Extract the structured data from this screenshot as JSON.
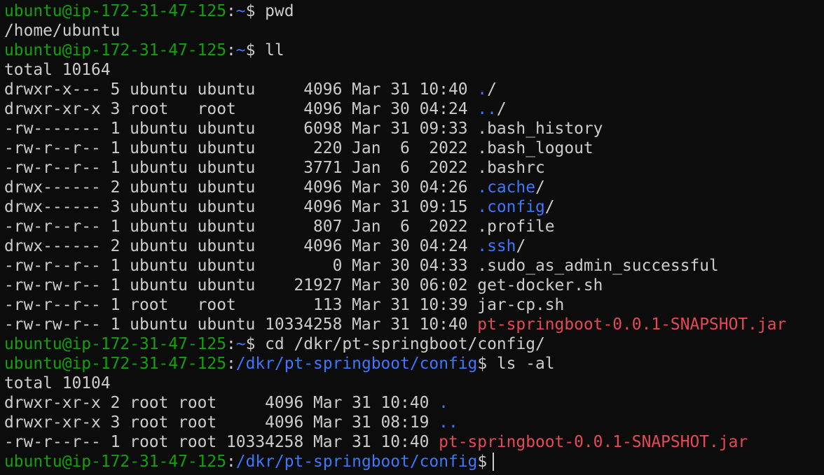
{
  "colors": {
    "background": "#0c0c0c",
    "text": "#cccccc",
    "prompt_user": "#13a10e",
    "prompt_path": "#3b78ff",
    "directory": "#3b78ff",
    "archive": "#e74856"
  },
  "lines": [
    {
      "segs": [
        {
          "t": "ubuntu@ip-172-31-47-125",
          "c": "u"
        },
        {
          "t": ":",
          "c": "w"
        },
        {
          "t": "~",
          "c": "p"
        },
        {
          "t": "$ pwd",
          "c": "w"
        }
      ]
    },
    {
      "segs": [
        {
          "t": "/home/ubuntu",
          "c": "w"
        }
      ]
    },
    {
      "segs": [
        {
          "t": "ubuntu@ip-172-31-47-125",
          "c": "u"
        },
        {
          "t": ":",
          "c": "w"
        },
        {
          "t": "~",
          "c": "p"
        },
        {
          "t": "$ ll",
          "c": "w"
        }
      ]
    },
    {
      "segs": [
        {
          "t": "total 10164",
          "c": "w"
        }
      ]
    },
    {
      "segs": [
        {
          "t": "drwxr-x--- 5 ubuntu ubuntu     4096 Mar 31 10:40 ",
          "c": "w"
        },
        {
          "t": ".",
          "c": "p"
        },
        {
          "t": "/",
          "c": "w"
        }
      ]
    },
    {
      "segs": [
        {
          "t": "drwxr-xr-x 3 root   root       4096 Mar 30 04:24 ",
          "c": "w"
        },
        {
          "t": "..",
          "c": "p"
        },
        {
          "t": "/",
          "c": "w"
        }
      ]
    },
    {
      "segs": [
        {
          "t": "-rw------- 1 ubuntu ubuntu     6098 Mar 31 09:33 .bash_history",
          "c": "w"
        }
      ]
    },
    {
      "segs": [
        {
          "t": "-rw-r--r-- 1 ubuntu ubuntu      220 Jan  6  2022 .bash_logout",
          "c": "w"
        }
      ]
    },
    {
      "segs": [
        {
          "t": "-rw-r--r-- 1 ubuntu ubuntu     3771 Jan  6  2022 .bashrc",
          "c": "w"
        }
      ]
    },
    {
      "segs": [
        {
          "t": "drwx------ 2 ubuntu ubuntu     4096 Mar 30 04:26 ",
          "c": "w"
        },
        {
          "t": ".cache",
          "c": "p"
        },
        {
          "t": "/",
          "c": "w"
        }
      ]
    },
    {
      "segs": [
        {
          "t": "drwx------ 3 ubuntu ubuntu     4096 Mar 31 09:15 ",
          "c": "w"
        },
        {
          "t": ".config",
          "c": "p"
        },
        {
          "t": "/",
          "c": "w"
        }
      ]
    },
    {
      "segs": [
        {
          "t": "-rw-r--r-- 1 ubuntu ubuntu      807 Jan  6  2022 .profile",
          "c": "w"
        }
      ]
    },
    {
      "segs": [
        {
          "t": "drwx------ 2 ubuntu ubuntu     4096 Mar 30 04:24 ",
          "c": "w"
        },
        {
          "t": ".ssh",
          "c": "p"
        },
        {
          "t": "/",
          "c": "w"
        }
      ]
    },
    {
      "segs": [
        {
          "t": "-rw-r--r-- 1 ubuntu ubuntu        0 Mar 30 04:33 .sudo_as_admin_successful",
          "c": "w"
        }
      ]
    },
    {
      "segs": [
        {
          "t": "-rw-rw-r-- 1 ubuntu ubuntu    21927 Mar 30 06:02 get-docker.sh",
          "c": "w"
        }
      ]
    },
    {
      "segs": [
        {
          "t": "-rw-r--r-- 1 root   root        113 Mar 31 10:39 jar-cp.sh",
          "c": "w"
        }
      ]
    },
    {
      "segs": [
        {
          "t": "-rw-rw-r-- 1 ubuntu ubuntu 10334258 Mar 31 10:40 ",
          "c": "w"
        },
        {
          "t": "pt-springboot-0.0.1-SNAPSHOT.jar",
          "c": "r"
        }
      ]
    },
    {
      "segs": [
        {
          "t": "ubuntu@ip-172-31-47-125",
          "c": "u"
        },
        {
          "t": ":",
          "c": "w"
        },
        {
          "t": "~",
          "c": "p"
        },
        {
          "t": "$ cd /dkr/pt-springboot/config/",
          "c": "w"
        }
      ]
    },
    {
      "segs": [
        {
          "t": "ubuntu@ip-172-31-47-125",
          "c": "u"
        },
        {
          "t": ":",
          "c": "w"
        },
        {
          "t": "/dkr/pt-springboot/config",
          "c": "p"
        },
        {
          "t": "$ ls -al",
          "c": "w"
        }
      ]
    },
    {
      "segs": [
        {
          "t": "total 10104",
          "c": "w"
        }
      ]
    },
    {
      "segs": [
        {
          "t": "drwxr-xr-x 2 root root     4096 Mar 31 10:40 ",
          "c": "w"
        },
        {
          "t": ".",
          "c": "p"
        }
      ]
    },
    {
      "segs": [
        {
          "t": "drwxr-xr-x 3 root root     4096 Mar 31 08:19 ",
          "c": "w"
        },
        {
          "t": "..",
          "c": "p"
        }
      ]
    },
    {
      "segs": [
        {
          "t": "-rw-r--r-- 1 root root 10334258 Mar 31 10:40 ",
          "c": "w"
        },
        {
          "t": "pt-springboot-0.0.1-SNAPSHOT.jar",
          "c": "r"
        }
      ]
    },
    {
      "segs": [
        {
          "t": "ubuntu@ip-172-31-47-125",
          "c": "u"
        },
        {
          "t": ":",
          "c": "w"
        },
        {
          "t": "/dkr/pt-springboot/config",
          "c": "p"
        },
        {
          "t": "$",
          "c": "w"
        }
      ],
      "cursor": true
    }
  ]
}
